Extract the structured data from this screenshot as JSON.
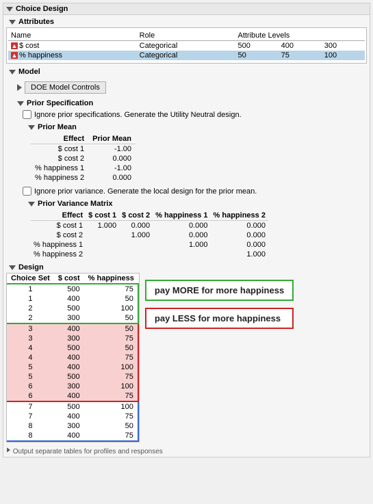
{
  "title": "Choice Design",
  "attributes": {
    "header": "Attributes",
    "columns": [
      "Name",
      "Role",
      "Attribute Levels"
    ],
    "rows": [
      {
        "name": "$ cost",
        "role": "Categorical",
        "levels": [
          "500",
          "400",
          "300"
        ],
        "highlighted": false
      },
      {
        "name": "% happiness",
        "role": "Categorical",
        "levels": [
          "50",
          "75",
          "100"
        ],
        "highlighted": true
      }
    ]
  },
  "model": {
    "header": "Model",
    "doe_button": "DOE Model Controls",
    "prior_spec_header": "Prior Specification",
    "ignore_prior_label": "Ignore prior specifications. Generate the Utility Neutral design.",
    "prior_mean_header": "Prior Mean",
    "prior_mean_columns": [
      "Effect",
      "Prior Mean"
    ],
    "prior_mean_rows": [
      {
        "effect": "$ cost 1",
        "value": "-1.00"
      },
      {
        "effect": "$ cost 2",
        "value": "0.000"
      },
      {
        "effect": "% happiness 1",
        "value": "-1.00"
      },
      {
        "effect": "% happiness 2",
        "value": "0.000"
      }
    ],
    "ignore_variance_label": "Ignore prior variance. Generate the local design for the prior mean.",
    "prior_variance_header": "Prior Variance Matrix",
    "prior_variance_columns": [
      "Effect",
      "$ cost 1",
      "$ cost 2",
      "% happiness 1",
      "% happiness 2"
    ],
    "prior_variance_rows": [
      {
        "effect": "$ cost 1",
        "values": [
          "1.000",
          "0.000",
          "0.000",
          "0.000"
        ]
      },
      {
        "effect": "$ cost 2",
        "values": [
          "",
          "1.000",
          "0.000",
          "0.000"
        ]
      },
      {
        "effect": "% happiness 1",
        "values": [
          "",
          "",
          "1.000",
          "0.000"
        ]
      },
      {
        "effect": "% happiness 2",
        "values": [
          "",
          "",
          "",
          "1.000"
        ]
      }
    ]
  },
  "design": {
    "header": "Design",
    "table_columns": [
      "Choice Set",
      "$ cost",
      "% happiness"
    ],
    "groups": [
      {
        "color": "blue",
        "rows": [
          {
            "set": "1",
            "cost": "500",
            "happiness": "75"
          },
          {
            "set": "1",
            "cost": "400",
            "happiness": "50"
          },
          {
            "set": "2",
            "cost": "500",
            "happiness": "100"
          },
          {
            "set": "2",
            "cost": "300",
            "happiness": "50"
          }
        ]
      },
      {
        "color": "red",
        "rows": [
          {
            "set": "3",
            "cost": "400",
            "happiness": "50"
          },
          {
            "set": "3",
            "cost": "300",
            "happiness": "75"
          },
          {
            "set": "4",
            "cost": "500",
            "happiness": "50"
          },
          {
            "set": "4",
            "cost": "400",
            "happiness": "75"
          },
          {
            "set": "5",
            "cost": "400",
            "happiness": "100"
          },
          {
            "set": "5",
            "cost": "500",
            "happiness": "75"
          },
          {
            "set": "6",
            "cost": "300",
            "happiness": "100"
          },
          {
            "set": "6",
            "cost": "400",
            "happiness": "75"
          }
        ]
      },
      {
        "color": "blue2",
        "rows": [
          {
            "set": "7",
            "cost": "500",
            "happiness": "100"
          },
          {
            "set": "7",
            "cost": "400",
            "happiness": "75"
          },
          {
            "set": "8",
            "cost": "300",
            "happiness": "50"
          },
          {
            "set": "8",
            "cost": "400",
            "happiness": "75"
          }
        ]
      }
    ],
    "annotation_green": "pay MORE for more happiness",
    "annotation_red": "pay LESS for more happiness"
  },
  "bottom_text": "Output separate tables for profiles and responses"
}
